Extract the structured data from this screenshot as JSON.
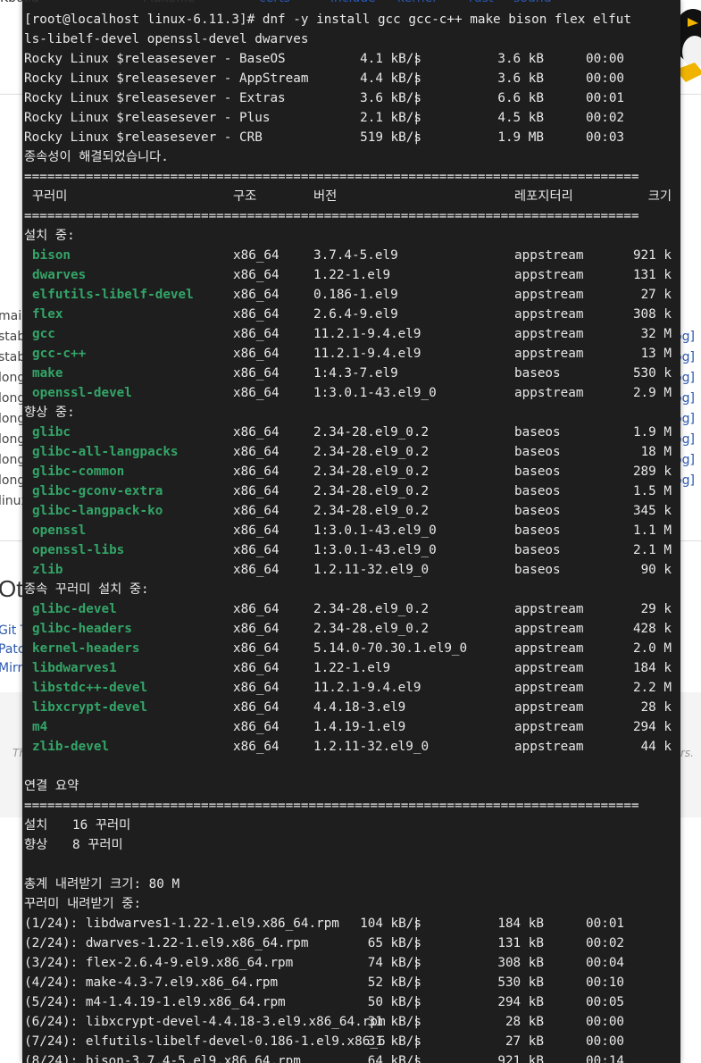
{
  "background": {
    "top_row": [
      "Kbuild",
      "Makefile",
      "certs",
      "include",
      "kernel",
      "rust",
      "sound"
    ],
    "left_labels": [
      "mair",
      "stab",
      "stab",
      "long",
      "long",
      "long",
      "long",
      "long",
      "long",
      "linux"
    ],
    "right_links": [
      "og]",
      "og]",
      "og]",
      "og]",
      "og]",
      "og]",
      "og]",
      "og]"
    ],
    "other_heading": "Oth",
    "other_links": [
      "Git T",
      "Patc",
      "Mirro"
    ],
    "footer_left": "Th",
    "footer_right": "rs."
  },
  "terminal": {
    "prompt_line_1": "[root@localhost linux-6.11.3]# dnf -y install gcc gcc-c++ make bison flex elfut",
    "prompt_line_2": "ls-libelf-devel openssl-devel dwarves",
    "repos": [
      {
        "name": "Rocky Linux $releasesever - BaseOS",
        "speed": "4.1 kB/s",
        "size": "3.6 kB",
        "time": "00:00"
      },
      {
        "name": "Rocky Linux $releasesever - AppStream",
        "speed": "4.4 kB/s",
        "size": "3.6 kB",
        "time": "00:00"
      },
      {
        "name": "Rocky Linux $releasesever - Extras",
        "speed": "3.6 kB/s",
        "size": "6.6 kB",
        "time": "00:01"
      },
      {
        "name": "Rocky Linux $releasesever - Plus",
        "speed": "2.1 kB/s",
        "size": "4.5 kB",
        "time": "00:02"
      },
      {
        "name": "Rocky Linux $releasesever - CRB",
        "speed": "519 kB/s",
        "size": "1.9 MB",
        "time": "00:03"
      }
    ],
    "deps_resolved": "종속성이 해결되었습니다.",
    "separator": "================================================================================",
    "headers": {
      "package": "꾸러미",
      "arch": "구조",
      "version": "버전",
      "repo": "레포지터리",
      "size": "크기"
    },
    "sections": [
      {
        "title": "설치 중:",
        "rows": [
          {
            "name": "bison",
            "arch": "x86_64",
            "version": "3.7.4-5.el9",
            "repo": "appstream",
            "size": "921 k"
          },
          {
            "name": "dwarves",
            "arch": "x86_64",
            "version": "1.22-1.el9",
            "repo": "appstream",
            "size": "131 k"
          },
          {
            "name": "elfutils-libelf-devel",
            "arch": "x86_64",
            "version": "0.186-1.el9",
            "repo": "appstream",
            "size": "27 k"
          },
          {
            "name": "flex",
            "arch": "x86_64",
            "version": "2.6.4-9.el9",
            "repo": "appstream",
            "size": "308 k"
          },
          {
            "name": "gcc",
            "arch": "x86_64",
            "version": "11.2.1-9.4.el9",
            "repo": "appstream",
            "size": "32 M"
          },
          {
            "name": "gcc-c++",
            "arch": "x86_64",
            "version": "11.2.1-9.4.el9",
            "repo": "appstream",
            "size": "13 M"
          },
          {
            "name": "make",
            "arch": "x86_64",
            "version": "1:4.3-7.el9",
            "repo": "baseos",
            "size": "530 k"
          },
          {
            "name": "openssl-devel",
            "arch": "x86_64",
            "version": "1:3.0.1-43.el9_0",
            "repo": "appstream",
            "size": "2.9 M"
          }
        ]
      },
      {
        "title": "향상 중:",
        "rows": [
          {
            "name": "glibc",
            "arch": "x86_64",
            "version": "2.34-28.el9_0.2",
            "repo": "baseos",
            "size": "1.9 M"
          },
          {
            "name": "glibc-all-langpacks",
            "arch": "x86_64",
            "version": "2.34-28.el9_0.2",
            "repo": "baseos",
            "size": "18 M"
          },
          {
            "name": "glibc-common",
            "arch": "x86_64",
            "version": "2.34-28.el9_0.2",
            "repo": "baseos",
            "size": "289 k"
          },
          {
            "name": "glibc-gconv-extra",
            "arch": "x86_64",
            "version": "2.34-28.el9_0.2",
            "repo": "baseos",
            "size": "1.5 M"
          },
          {
            "name": "glibc-langpack-ko",
            "arch": "x86_64",
            "version": "2.34-28.el9_0.2",
            "repo": "baseos",
            "size": "345 k"
          },
          {
            "name": "openssl",
            "arch": "x86_64",
            "version": "1:3.0.1-43.el9_0",
            "repo": "baseos",
            "size": "1.1 M"
          },
          {
            "name": "openssl-libs",
            "arch": "x86_64",
            "version": "1:3.0.1-43.el9_0",
            "repo": "baseos",
            "size": "2.1 M"
          },
          {
            "name": "zlib",
            "arch": "x86_64",
            "version": "1.2.11-32.el9_0",
            "repo": "baseos",
            "size": "90 k"
          }
        ]
      },
      {
        "title": "종속 꾸러미 설치 중:",
        "rows": [
          {
            "name": "glibc-devel",
            "arch": "x86_64",
            "version": "2.34-28.el9_0.2",
            "repo": "appstream",
            "size": "29 k"
          },
          {
            "name": "glibc-headers",
            "arch": "x86_64",
            "version": "2.34-28.el9_0.2",
            "repo": "appstream",
            "size": "428 k"
          },
          {
            "name": "kernel-headers",
            "arch": "x86_64",
            "version": "5.14.0-70.30.1.el9_0",
            "repo": "appstream",
            "size": "2.0 M"
          },
          {
            "name": "libdwarves1",
            "arch": "x86_64",
            "version": "1.22-1.el9",
            "repo": "appstream",
            "size": "184 k"
          },
          {
            "name": "libstdc++-devel",
            "arch": "x86_64",
            "version": "11.2.1-9.4.el9",
            "repo": "appstream",
            "size": "2.2 M"
          },
          {
            "name": "libxcrypt-devel",
            "arch": "x86_64",
            "version": "4.4.18-3.el9",
            "repo": "appstream",
            "size": "28 k"
          },
          {
            "name": "m4",
            "arch": "x86_64",
            "version": "1.4.19-1.el9",
            "repo": "appstream",
            "size": "294 k"
          },
          {
            "name": "zlib-devel",
            "arch": "x86_64",
            "version": "1.2.11-32.el9_0",
            "repo": "appstream",
            "size": "44 k"
          }
        ]
      }
    ],
    "summary_title": "연결 요약",
    "summary": [
      {
        "label": "설치",
        "count": "16 꾸러미"
      },
      {
        "label": "향상",
        "count": "8 꾸러미"
      }
    ],
    "total_download": "총계 내려받기 크기: 80 M",
    "downloading": "꾸러미 내려받기 중:",
    "downloads": [
      {
        "file": "(1/24): libdwarves1-1.22-1.el9.x86_64.rpm",
        "speed": "104 kB/s",
        "size": "184 kB",
        "time": "00:01"
      },
      {
        "file": "(2/24): dwarves-1.22-1.el9.x86_64.rpm",
        "speed": "65 kB/s",
        "size": "131 kB",
        "time": "00:02"
      },
      {
        "file": "(3/24): flex-2.6.4-9.el9.x86_64.rpm",
        "speed": "74 kB/s",
        "size": "308 kB",
        "time": "00:04"
      },
      {
        "file": "(4/24): make-4.3-7.el9.x86_64.rpm",
        "speed": "52 kB/s",
        "size": "530 kB",
        "time": "00:10"
      },
      {
        "file": "(5/24): m4-1.4.19-1.el9.x86_64.rpm",
        "speed": "50 kB/s",
        "size": "294 kB",
        "time": "00:05"
      },
      {
        "file": "(6/24): libxcrypt-devel-4.4.18-3.el9.x86_64.rpm",
        "speed": "31 kB/s",
        "size": "28 kB",
        "time": "00:00"
      },
      {
        "file": "(7/24): elfutils-libelf-devel-0.186-1.el9.x86_6",
        "speed": "31 kB/s",
        "size": "27 kB",
        "time": "00:00"
      },
      {
        "file": "(8/24): bison-3.7.4-5.el9.x86_64.rpm",
        "speed": "64 kB/s",
        "size": "921 kB",
        "time": "00:14"
      }
    ],
    "colors": {
      "background": "#1e1e1e",
      "text": "#e8e8e8",
      "package": "#33a567"
    }
  }
}
